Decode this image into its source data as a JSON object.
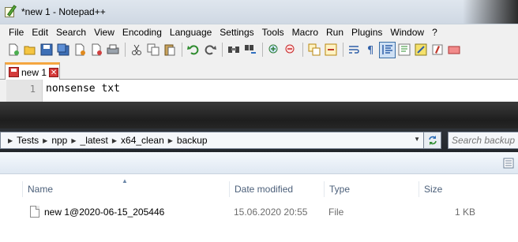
{
  "notepad": {
    "window_title": "*new 1 - Notepad++",
    "menu": [
      "File",
      "Edit",
      "Search",
      "View",
      "Encoding",
      "Language",
      "Settings",
      "Tools",
      "Macro",
      "Run",
      "Plugins",
      "Window",
      "?"
    ],
    "toolbar_icons": [
      "new-file-icon",
      "open-file-icon",
      "save-icon",
      "save-all-icon",
      "close-icon",
      "close-all-icon",
      "print-icon",
      "cut-icon",
      "copy-icon",
      "paste-icon",
      "undo-icon",
      "redo-icon",
      "find-icon",
      "replace-icon",
      "zoom-in-icon",
      "zoom-out-icon",
      "sync-vertical-icon",
      "sync-horizontal-icon",
      "word-wrap-icon",
      "show-all-chars-icon",
      "indent-guide-icon",
      "language-icon",
      "bookmark-icon",
      "record-macro-icon",
      "play-macro-icon"
    ],
    "tab": {
      "label": "new 1"
    },
    "editor": {
      "line_number": "1",
      "text": "nonsense txt"
    }
  },
  "explorer": {
    "breadcrumb": [
      "Tests",
      "npp",
      "_latest",
      "x64_clean",
      "backup"
    ],
    "search": {
      "placeholder": "Search backup"
    },
    "columns": {
      "name": "Name",
      "date_modified": "Date modified",
      "type": "Type",
      "size": "Size"
    },
    "files": [
      {
        "name": "new 1@2020-06-15_205446",
        "date_modified": "15.06.2020 20:55",
        "type": "File",
        "size": "1 KB"
      }
    ]
  },
  "colors": {
    "tab_accent": "#f4a640",
    "header_text": "#4c607a",
    "dark_gap": "#1e1e1e"
  }
}
